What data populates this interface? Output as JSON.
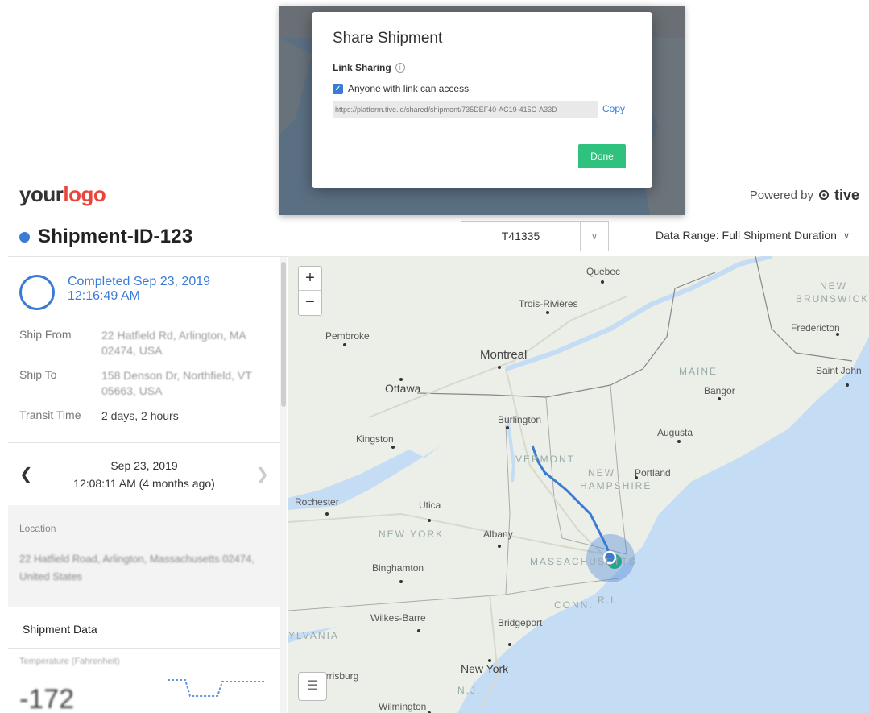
{
  "header": {
    "logo_your": "your",
    "logo_word": "logo",
    "powered_by": "Powered by",
    "brand": "tive"
  },
  "shipment": {
    "title": "Shipment-ID-123",
    "device": "T41335",
    "data_range": "Data Range: Full Shipment Duration"
  },
  "status": {
    "completed_line1": "Completed Sep 23, 2019",
    "completed_line2": "12:16:49 AM"
  },
  "info": {
    "ship_from_label": "Ship From",
    "ship_from_value": "22 Hatfield Rd, Arlington, MA 02474, USA",
    "ship_to_label": "Ship To",
    "ship_to_value": "158 Denson Dr, Northfield, VT 05663, USA",
    "transit_label": "Transit Time",
    "transit_value": "2 days, 2 hours"
  },
  "nav": {
    "date": "Sep 23, 2019",
    "time": "12:08:11 AM",
    "ago": "(4 months ago)"
  },
  "location": {
    "label": "Location",
    "address": "22 Hatfield Road, Arlington, Massachusetts 02474, United States"
  },
  "shipment_data": {
    "label": "Shipment Data",
    "sub": "Temperature (Fahrenheit)",
    "value": "-172"
  },
  "map": {
    "zoom_in": "+",
    "zoom_out": "−",
    "labels": {
      "quebec": "Quebec",
      "trois": "Trois-Rivières",
      "new_brunswick_1": "NEW",
      "new_brunswick_2": "BRUNSWICK",
      "pembroke": "Pembroke",
      "fredericton": "Fredericton",
      "montreal": "Montreal",
      "ottawa": "Ottawa",
      "maine": "MAINE",
      "saint_john": "Saint John",
      "bangor": "Bangor",
      "burlington": "Burlington",
      "augusta": "Augusta",
      "kingston": "Kingston",
      "vermont": "VERMONT",
      "new_hampshire_1": "NEW",
      "new_hampshire_2": "HAMPSHIRE",
      "portland": "Portland",
      "rochester": "Rochester",
      "utica": "Utica",
      "new_york_state": "NEW YORK",
      "albany": "Albany",
      "massachusetts": "MASSACHUSETTS",
      "binghamton": "Binghamton",
      "conn": "CONN.",
      "ri": "R.I.",
      "wilkes_barre": "Wilkes-Barre",
      "bridgeport": "Bridgeport",
      "pennsylvania": "YLVANIA",
      "new_york_city": "New York",
      "harrisburg": "arrisburg",
      "nj": "N.J.",
      "wilmington": "Wilmington"
    }
  },
  "modal": {
    "title": "Share Shipment",
    "link_sharing": "Link Sharing",
    "info_glyph": "i",
    "checkbox_label": "Anyone with link can access",
    "link": "https://platform.tive.io/shared/shipment/735DEF40-AC19-415C-A33D",
    "copy": "Copy",
    "done": "Done"
  },
  "colors": {
    "accent": "#3a7bd5",
    "done_button": "#2ec27e",
    "logo_red": "#e8453c",
    "water": "#c5dcf5",
    "land": "#eceee8"
  }
}
